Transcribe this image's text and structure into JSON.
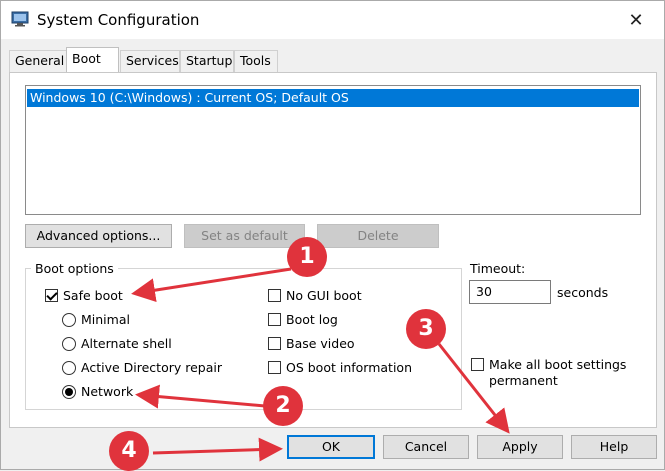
{
  "window": {
    "title": "System Configuration",
    "close_glyph": "✕"
  },
  "tabs": [
    "General",
    "Boot",
    "Services",
    "Startup",
    "Tools"
  ],
  "active_tab": "Boot",
  "os_list": {
    "items": [
      "Windows 10 (C:\\Windows) : Current OS; Default OS"
    ],
    "selected_index": 0
  },
  "actions": {
    "advanced": "Advanced options...",
    "set_default": "Set as default",
    "delete": "Delete"
  },
  "boot_options": {
    "group_label": "Boot options",
    "safe_boot": {
      "label": "Safe boot",
      "checked": true
    },
    "radios": [
      {
        "label": "Minimal",
        "checked": false
      },
      {
        "label": "Alternate shell",
        "checked": false
      },
      {
        "label": "Active Directory repair",
        "checked": false
      },
      {
        "label": "Network",
        "checked": true
      }
    ],
    "right_checks": [
      {
        "label": "No GUI boot",
        "checked": false
      },
      {
        "label": "Boot log",
        "checked": false
      },
      {
        "label": "Base video",
        "checked": false
      },
      {
        "label": "OS boot information",
        "checked": false
      }
    ]
  },
  "timeout": {
    "label": "Timeout:",
    "value": "30",
    "unit": "seconds"
  },
  "permanent": {
    "line1": "Make all boot settings",
    "line2": "permanent",
    "checked": false
  },
  "footer": {
    "ok": "OK",
    "cancel": "Cancel",
    "apply": "Apply",
    "help": "Help"
  },
  "annotations": {
    "badges": [
      "1",
      "2",
      "3",
      "4"
    ],
    "color": "#e0333c"
  }
}
